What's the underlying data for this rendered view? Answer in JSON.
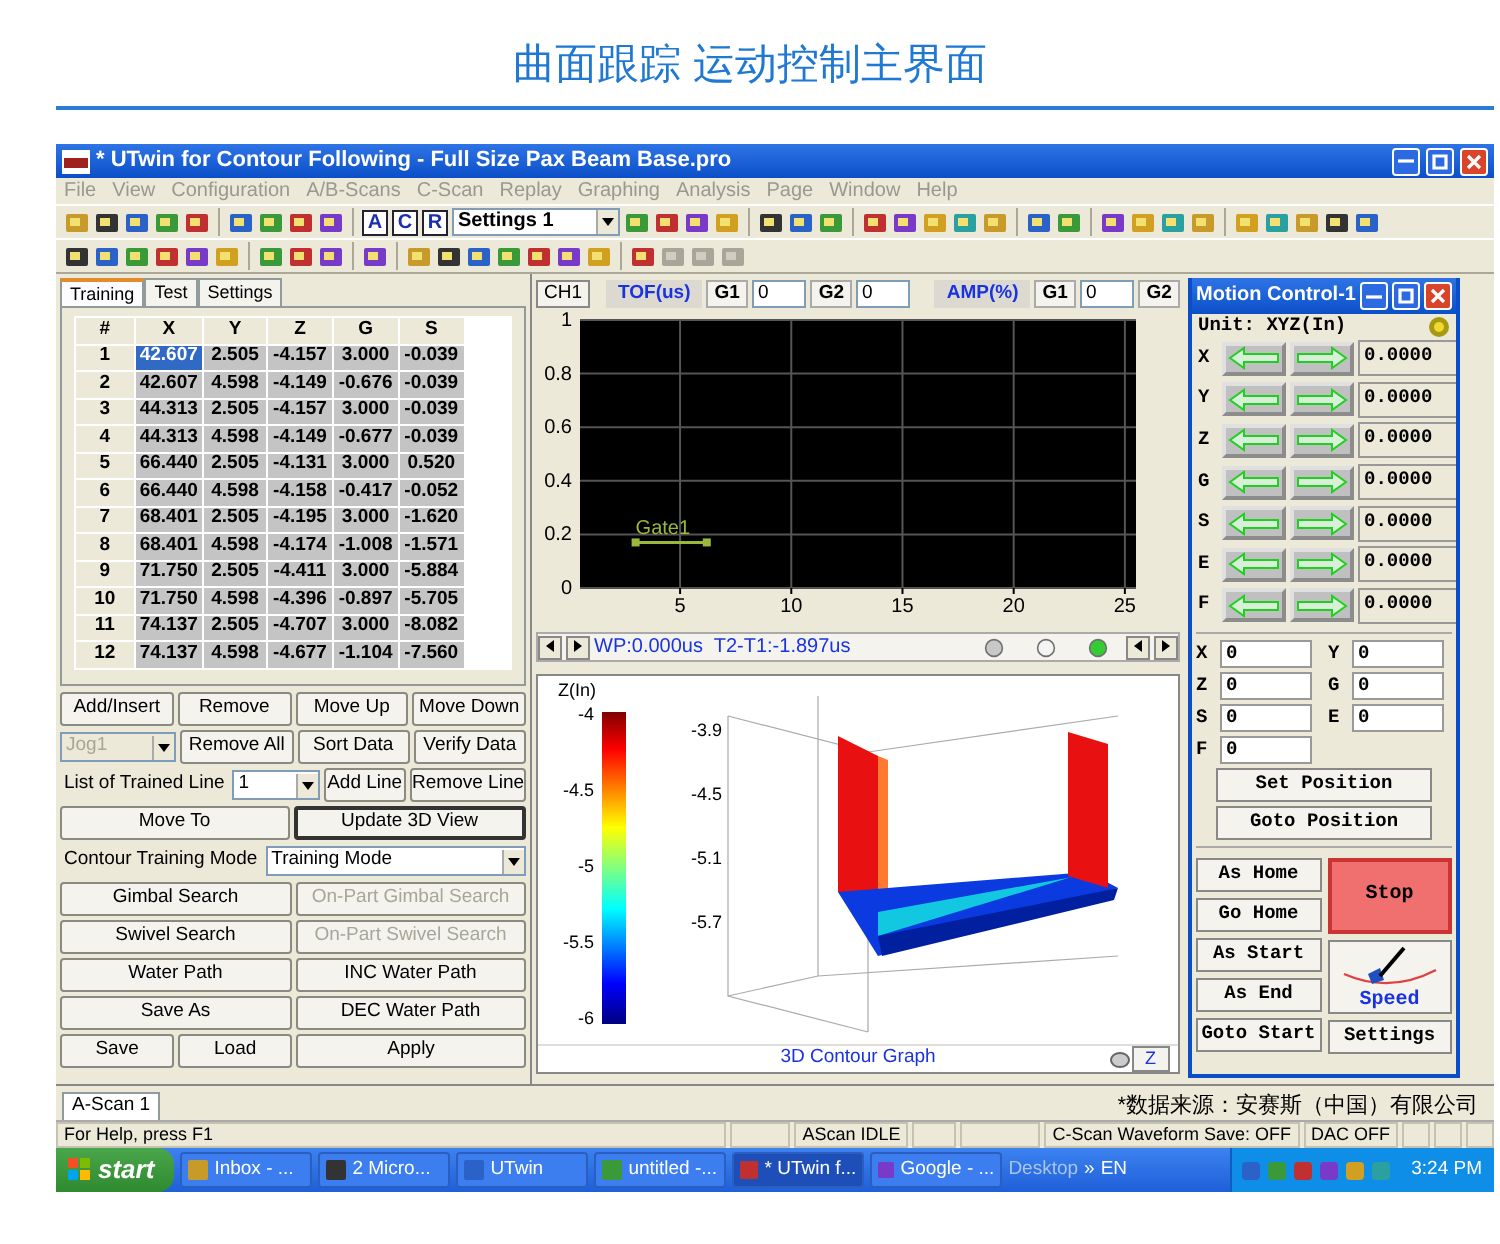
{
  "page_title": "曲面跟踪 运动控制主界面",
  "window": {
    "title": "* UTwin for Contour Following - Full Size Pax Beam Base.pro"
  },
  "menu": [
    {
      "label": "File",
      "disabled": true
    },
    {
      "label": "View",
      "disabled": true
    },
    {
      "label": "Configuration",
      "disabled": true
    },
    {
      "label": "A/B-Scans",
      "disabled": true
    },
    {
      "label": "C-Scan",
      "disabled": true
    },
    {
      "label": "Replay",
      "disabled": true
    },
    {
      "label": "Graphing",
      "disabled": true
    },
    {
      "label": "Analysis",
      "disabled": true
    },
    {
      "label": "Page",
      "disabled": true
    },
    {
      "label": "Window",
      "disabled": true
    },
    {
      "label": "Help",
      "disabled": true
    }
  ],
  "toolbar": {
    "letter_buttons": [
      "A",
      "C",
      "R"
    ],
    "settings_select": "Settings 1"
  },
  "left_tabs": [
    {
      "label": "Training",
      "selected": true
    },
    {
      "label": "Test",
      "selected": false
    },
    {
      "label": "Settings",
      "selected": false
    }
  ],
  "table": {
    "columns": [
      "#",
      "X",
      "Y",
      "Z",
      "G",
      "S"
    ],
    "rows": [
      {
        "cells": [
          "1",
          "42.607",
          "2.505",
          "-4.157",
          "3.000",
          "-0.039"
        ],
        "selected": true
      },
      {
        "cells": [
          "2",
          "42.607",
          "4.598",
          "-4.149",
          "-0.676",
          "-0.039"
        ],
        "selected": false
      },
      {
        "cells": [
          "3",
          "44.313",
          "2.505",
          "-4.157",
          "3.000",
          "-0.039"
        ],
        "selected": false
      },
      {
        "cells": [
          "4",
          "44.313",
          "4.598",
          "-4.149",
          "-0.677",
          "-0.039"
        ],
        "selected": false
      },
      {
        "cells": [
          "5",
          "66.440",
          "2.505",
          "-4.131",
          "3.000",
          "0.520"
        ],
        "selected": false
      },
      {
        "cells": [
          "6",
          "66.440",
          "4.598",
          "-4.158",
          "-0.417",
          "-0.052"
        ],
        "selected": false
      },
      {
        "cells": [
          "7",
          "68.401",
          "2.505",
          "-4.195",
          "3.000",
          "-1.620"
        ],
        "selected": false
      },
      {
        "cells": [
          "8",
          "68.401",
          "4.598",
          "-4.174",
          "-1.008",
          "-1.571"
        ],
        "selected": false
      },
      {
        "cells": [
          "9",
          "71.750",
          "2.505",
          "-4.411",
          "3.000",
          "-5.884"
        ],
        "selected": false
      },
      {
        "cells": [
          "10",
          "71.750",
          "4.598",
          "-4.396",
          "-0.897",
          "-5.705"
        ],
        "selected": false
      },
      {
        "cells": [
          "11",
          "74.137",
          "2.505",
          "-4.707",
          "3.000",
          "-8.082"
        ],
        "selected": false
      },
      {
        "cells": [
          "12",
          "74.137",
          "4.598",
          "-4.677",
          "-1.104",
          "-7.560"
        ],
        "selected": false
      }
    ]
  },
  "training_controls": [
    [
      {
        "kind": "button",
        "label": "Add/Insert",
        "disabled": false
      },
      {
        "kind": "button",
        "label": "Remove",
        "disabled": false
      },
      {
        "kind": "button",
        "label": "Move Up",
        "disabled": false
      },
      {
        "kind": "button",
        "label": "Move Down",
        "disabled": false
      }
    ],
    [
      {
        "kind": "select",
        "value": "Jog1",
        "disabled": true
      },
      {
        "kind": "button",
        "label": "Remove All",
        "disabled": false
      },
      {
        "kind": "button",
        "label": "Sort Data",
        "disabled": false
      },
      {
        "kind": "button",
        "label": "Verify Data",
        "disabled": false
      }
    ],
    [
      {
        "kind": "label",
        "label": "List of Trained Line"
      },
      {
        "kind": "select",
        "value": "1",
        "disabled": false
      },
      {
        "kind": "button",
        "label": "Add Line",
        "disabled": false
      },
      {
        "kind": "button",
        "label": "Remove Line",
        "disabled": false
      }
    ],
    [
      {
        "kind": "button",
        "label": "Move To",
        "disabled": false
      },
      {
        "kind": "default_button",
        "label": "Update 3D View",
        "disabled": false
      }
    ],
    [
      {
        "kind": "label",
        "label": "Contour Training Mode"
      },
      {
        "kind": "wide_select",
        "value": "Training Mode",
        "disabled": false
      }
    ],
    [
      {
        "kind": "button",
        "label": "Gimbal Search",
        "disabled": false
      },
      {
        "kind": "button",
        "label": "On-Part Gimbal Search",
        "disabled": true
      }
    ],
    [
      {
        "kind": "button",
        "label": "Swivel Search",
        "disabled": false
      },
      {
        "kind": "button",
        "label": "On-Part Swivel Search",
        "disabled": true
      }
    ],
    [
      {
        "kind": "button",
        "label": "Water Path",
        "disabled": false
      },
      {
        "kind": "button",
        "label": "INC Water Path",
        "disabled": false
      }
    ],
    [
      {
        "kind": "button",
        "label": "Save As",
        "disabled": false
      },
      {
        "kind": "button",
        "label": "DEC Water Path",
        "disabled": false
      }
    ],
    [
      {
        "kind": "button",
        "label": "Save",
        "disabled": false
      },
      {
        "kind": "button",
        "label": "Load",
        "disabled": false
      },
      {
        "kind": "wide_button",
        "label": "Apply",
        "disabled": false
      }
    ]
  ],
  "ascan": {
    "header": [
      {
        "kind": "button",
        "label": "CH1"
      },
      {
        "kind": "tag",
        "label": "TOF(us)"
      },
      {
        "kind": "label",
        "label": "G1"
      },
      {
        "kind": "field",
        "value": "0"
      },
      {
        "kind": "label",
        "label": "G2"
      },
      {
        "kind": "field",
        "value": "0"
      },
      {
        "kind": "tag",
        "label": "AMP(%)"
      },
      {
        "kind": "label",
        "label": "G1"
      },
      {
        "kind": "field",
        "value": "0"
      },
      {
        "kind": "label",
        "label": "G2"
      }
    ],
    "chart_data": {
      "type": "line",
      "xlim": [
        0.5,
        25.5
      ],
      "ylim": [
        0,
        1
      ],
      "xticks": [
        5,
        10,
        15,
        20,
        25
      ],
      "yticks": [
        0,
        0.2,
        0.4,
        0.6,
        0.8,
        1
      ],
      "grid": true,
      "annotations": [
        {
          "text": "Gate1",
          "x": 3,
          "y": 0.17
        }
      ]
    },
    "readout": "WP:0.000us  T2-T1:-1.897us",
    "indicators": [
      {
        "color": "#c8c8c8"
      },
      {
        "color": "#f4f4f4"
      },
      {
        "color": "#33cc33"
      }
    ]
  },
  "graph3d": {
    "axis_title": "Z(In)",
    "colorbar_ticks": [
      "-4",
      "-4.5",
      "-5",
      "-5.5",
      "-6"
    ],
    "z_ticks": [
      "-3.9",
      "-4.5",
      "-5.1",
      "-5.7"
    ],
    "caption": "3D Contour Graph",
    "axis_button": "Z"
  },
  "motion": {
    "title": "Motion Control-1",
    "unit": "Unit: XYZ(In)",
    "axes": [
      {
        "label": "X",
        "value": "0.0000"
      },
      {
        "label": "Y",
        "value": "0.0000"
      },
      {
        "label": "Z",
        "value": "0.0000"
      },
      {
        "label": "G",
        "value": "0.0000"
      },
      {
        "label": "S",
        "value": "0.0000"
      },
      {
        "label": "E",
        "value": "0.0000"
      },
      {
        "label": "F",
        "value": "0.0000"
      }
    ],
    "positions": [
      {
        "label": "X",
        "value": "0"
      },
      {
        "label": "Y",
        "value": "0"
      },
      {
        "label": "Z",
        "value": "0"
      },
      {
        "label": "G",
        "value": "0"
      },
      {
        "label": "S",
        "value": "0"
      },
      {
        "label": "E",
        "value": "0"
      },
      {
        "label": "F",
        "value": "0"
      }
    ],
    "position_buttons": [
      "Set Position",
      "Goto Position"
    ],
    "left_buttons": [
      "As Home",
      "Go Home",
      "As Start",
      "As End",
      "Goto Start"
    ],
    "stop": "Stop",
    "speed": "Speed",
    "settings": "Settings"
  },
  "bottom_tabs": [
    {
      "label": "A-Scan 1",
      "selected": true
    }
  ],
  "source_note": "*数据来源：安赛斯（中国）有限公司",
  "status_bar": [
    "For Help, press F1",
    "AScan IDLE",
    "C-Scan Waveform Save: OFF",
    "DAC OFF"
  ],
  "taskbar": {
    "start": "start",
    "items": [
      {
        "label": "Inbox - ...",
        "selected": false
      },
      {
        "label": "2 Micro...",
        "selected": false
      },
      {
        "label": "UTwin",
        "selected": false
      },
      {
        "label": "untitled -...",
        "selected": false
      },
      {
        "label": "* UTwin f...",
        "selected": true
      },
      {
        "label": "Google - ...",
        "selected": false
      }
    ],
    "desktop": "Desktop",
    "chevron": "»",
    "language": "EN",
    "clock": "3:24 PM"
  }
}
